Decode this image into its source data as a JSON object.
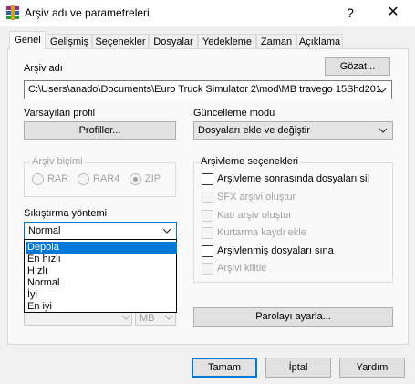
{
  "window": {
    "title": "Arşiv adı ve parametreleri",
    "help_label": "?",
    "close_label": "✕"
  },
  "tabs": [
    {
      "label": "Genel",
      "active": true
    },
    {
      "label": "Gelişmiş"
    },
    {
      "label": "Seçenekler"
    },
    {
      "label": "Dosyalar"
    },
    {
      "label": "Yedekleme"
    },
    {
      "label": "Zaman"
    },
    {
      "label": "Açıklama"
    }
  ],
  "general": {
    "archive_name_label": "Arşiv adı",
    "browse_label": "Gözat...",
    "archive_path": "C:\\Users\\anado\\Documents\\Euro Truck Simulator 2\\mod\\MB travego 15Shd201",
    "default_profile_label": "Varsayılan profil",
    "profiles_button": "Profiller...",
    "update_mode_label": "Güncelleme modu",
    "update_mode_value": "Dosyaları ekle ve değiştir",
    "archive_format": {
      "legend": "Arşiv biçimi",
      "options": [
        "RAR",
        "RAR4",
        "ZIP"
      ],
      "selected": "ZIP"
    },
    "compression": {
      "label": "Sıkıştırma yöntemi",
      "value": "Normal",
      "dropdown_items": [
        "Depola",
        "En hızlı",
        "Hızlı",
        "Normal",
        "İyi",
        "En iyi"
      ],
      "highlighted": "Depola"
    },
    "split_unit": "MB",
    "archiving_options": {
      "legend": "Arşivleme seçenekleri",
      "items": [
        {
          "label": "Arşivleme sonrasında dosyaları sil",
          "enabled": true,
          "checked": false
        },
        {
          "label": "SFX arşivi oluştur",
          "enabled": false,
          "checked": false
        },
        {
          "label": "Katı arşiv oluştur",
          "enabled": false,
          "checked": false
        },
        {
          "label": "Kurtarma kaydı ekle",
          "enabled": false,
          "checked": false
        },
        {
          "label": "Arşivlenmiş dosyaları sına",
          "enabled": true,
          "checked": false
        },
        {
          "label": "Arşivi kilitle",
          "enabled": false,
          "checked": false
        }
      ]
    },
    "set_password_button": "Parolayı ayarla..."
  },
  "footer": {
    "ok_label": "Tamam",
    "cancel_label": "İptal",
    "help_label": "Yardım"
  },
  "colors": {
    "accent": "#0078d7",
    "window_bg": "#f0f0f0",
    "panel_bg": "#f9f9f9"
  }
}
